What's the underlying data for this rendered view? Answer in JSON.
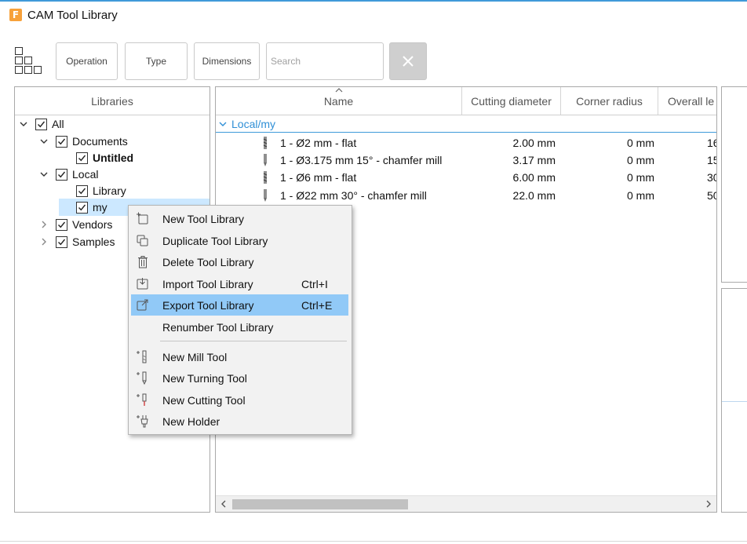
{
  "window": {
    "title": "CAM Tool Library",
    "logo_letter": "F"
  },
  "toolbar": {
    "grid_icon": "grid-view-icon",
    "filters": [
      {
        "label": "Operation"
      },
      {
        "label": "Type"
      },
      {
        "label": "Dimensions"
      }
    ],
    "search": {
      "placeholder": "Search",
      "value": ""
    },
    "clear_icon": "close-icon"
  },
  "libraries": {
    "header": "Libraries",
    "tree": [
      {
        "label": "All",
        "checked": true,
        "expanded": true
      },
      {
        "label": "Documents",
        "checked": true,
        "expanded": true
      },
      {
        "label": "Untitled",
        "checked": true,
        "bold": true
      },
      {
        "label": "Local",
        "checked": true,
        "expanded": true
      },
      {
        "label": "Library",
        "checked": true
      },
      {
        "label": "my",
        "checked": true,
        "selected": true
      },
      {
        "label": "Vendors",
        "checked": true,
        "expanded": false
      },
      {
        "label": "Samples",
        "checked": true,
        "expanded": false
      }
    ]
  },
  "tools": {
    "columns": [
      "Name",
      "Cutting diameter",
      "Corner radius",
      "Overall le"
    ],
    "group": "Local/my",
    "rows": [
      {
        "name": "1 - Ø2 mm - flat",
        "diameter": "2.00 mm",
        "radius": "0 mm",
        "length": "16"
      },
      {
        "name": "1 - Ø3.175 mm 15° - chamfer mill",
        "diameter": "3.17 mm",
        "radius": "0 mm",
        "length": "15"
      },
      {
        "name": "1 - Ø6 mm - flat",
        "diameter": "6.00 mm",
        "radius": "0 mm",
        "length": "30"
      },
      {
        "name": "1 - Ø22 mm 30° - chamfer mill",
        "diameter": "22.0 mm",
        "radius": "0 mm",
        "length": "50"
      }
    ]
  },
  "context_menu": {
    "items": [
      {
        "label": "New Tool Library",
        "icon": "new-library-icon",
        "shortcut": ""
      },
      {
        "label": "Duplicate Tool Library",
        "icon": "duplicate-icon",
        "shortcut": ""
      },
      {
        "label": "Delete Tool Library",
        "icon": "trash-icon",
        "shortcut": ""
      },
      {
        "label": "Import Tool Library",
        "icon": "import-icon",
        "shortcut": "Ctrl+I"
      },
      {
        "label": "Export Tool Library",
        "icon": "export-icon",
        "shortcut": "Ctrl+E",
        "highlighted": true
      },
      {
        "label": "Renumber Tool Library",
        "icon": "",
        "shortcut": ""
      },
      {
        "label": "New Mill Tool",
        "icon": "new-mill-tool-icon",
        "shortcut": ""
      },
      {
        "label": "New Turning Tool",
        "icon": "new-turning-tool-icon",
        "shortcut": ""
      },
      {
        "label": "New Cutting Tool",
        "icon": "new-cutting-tool-icon",
        "shortcut": ""
      },
      {
        "label": "New Holder",
        "icon": "new-holder-icon",
        "shortcut": ""
      }
    ]
  },
  "colors": {
    "accent": "#3f9ad9",
    "selection": "#cce8ff",
    "menu_highlight": "#91c9f7",
    "logo": "#f7a13a"
  }
}
